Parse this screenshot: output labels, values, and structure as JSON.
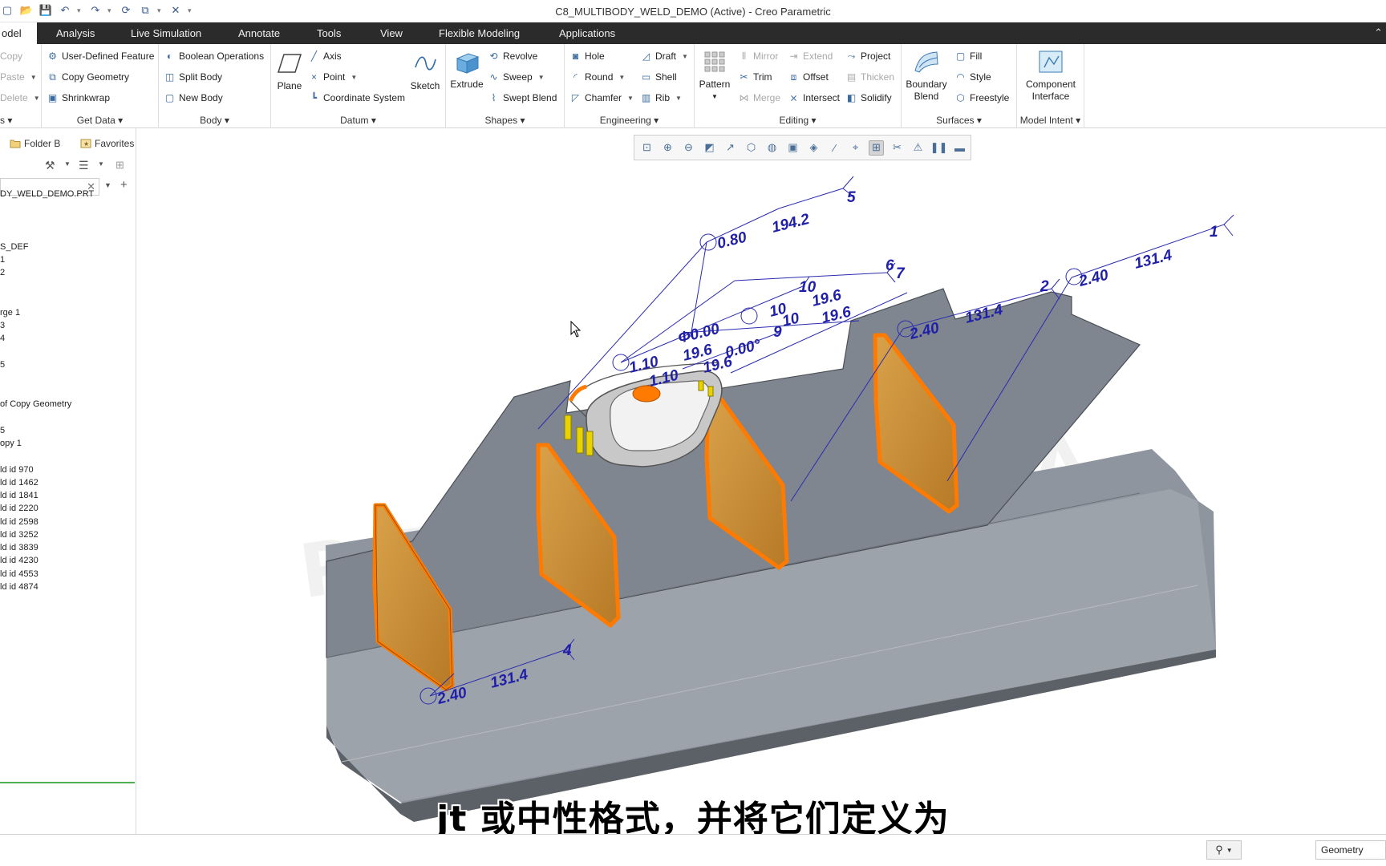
{
  "window": {
    "title": "C8_MULTIBODY_WELD_DEMO (Active) - Creo Parametric"
  },
  "tabs": [
    "odel",
    "Analysis",
    "Live Simulation",
    "Annotate",
    "Tools",
    "View",
    "Flexible Modeling",
    "Applications"
  ],
  "ribbon": {
    "clipboard": {
      "copy": "Copy",
      "paste": "Paste",
      "delete": "Delete",
      "label": "s"
    },
    "get_data": {
      "user_defined_feature": "User-Defined Feature",
      "copy_geometry": "Copy Geometry",
      "shrinkwrap": "Shrinkwrap",
      "label": "Get Data"
    },
    "body": {
      "boolean_operations": "Boolean Operations",
      "split_body": "Split Body",
      "new_body": "New Body",
      "label": "Body"
    },
    "datum": {
      "plane": "Plane",
      "axis": "Axis",
      "point": "Point",
      "coordinate_system": "Coordinate System",
      "sketch": "Sketch",
      "label": "Datum"
    },
    "shapes": {
      "extrude": "Extrude",
      "revolve": "Revolve",
      "sweep": "Sweep",
      "swept_blend": "Swept Blend",
      "label": "Shapes"
    },
    "engineering": {
      "hole": "Hole",
      "round": "Round",
      "chamfer": "Chamfer",
      "draft": "Draft",
      "shell": "Shell",
      "rib": "Rib",
      "label": "Engineering"
    },
    "editing": {
      "pattern": "Pattern",
      "mirror": "Mirror",
      "trim": "Trim",
      "merge": "Merge",
      "extend": "Extend",
      "offset": "Offset",
      "intersect": "Intersect",
      "project": "Project",
      "thicken": "Thicken",
      "solidify": "Solidify",
      "label": "Editing"
    },
    "surfaces": {
      "boundary_blend_1": "Boundary",
      "boundary_blend_2": "Blend",
      "fill": "Fill",
      "style": "Style",
      "freestyle": "Freestyle",
      "label": "Surfaces"
    },
    "model_intent": {
      "component_interface_1": "Component",
      "component_interface_2": "Interface",
      "label": "Model Intent"
    }
  },
  "left_panel": {
    "tabs": {
      "folder_browser": "Folder B",
      "favorites": "Favorites"
    },
    "tree": [
      "DY_WELD_DEMO.PRT",
      "S_DEF",
      "1",
      "2",
      "rge 1",
      "3",
      "4",
      "5",
      "of Copy Geometry",
      "5",
      "opy 1",
      "ld id 970",
      "ld id 1462",
      "ld id 1841",
      "ld id 2220",
      "ld id 2598",
      "ld id 3252",
      "ld id 3839",
      "ld id 4230",
      "ld id 4553",
      "ld id 4874"
    ]
  },
  "annotations": {
    "w5_a": "0.80",
    "w5_b": "194.2",
    "w5_n": "5",
    "w1_a": "2.40",
    "w1_b": "131.4",
    "w1_n": "1",
    "w2_a": "2.40",
    "w2_b": "131.4",
    "w2_n": "2",
    "w4_a": "2.40",
    "w4_b": "131.4",
    "w4_n": "4",
    "w67_n6": "6",
    "w67_n7": "7",
    "w10_n": "10",
    "w10_b": "19.6",
    "w10_c": "19.6",
    "center_a": "Φ0.00",
    "center_b": "19.6",
    "center_c": "19.6",
    "center_d": "0.00°",
    "center_e": "10",
    "center_f": "9",
    "center_g": "10",
    "left_a": "1.10",
    "left_b": "1.10"
  },
  "subtitle": "jt 或中性格式，并将它们定义为",
  "status": {
    "filter": "Geometry"
  },
  "colors": {
    "dim_blue": "#1f1fa8",
    "plate": "#8e949d",
    "rib_face": "#c98a2a",
    "rib_edge": "#ff7a00",
    "tabbar": "#2b2b2b"
  }
}
